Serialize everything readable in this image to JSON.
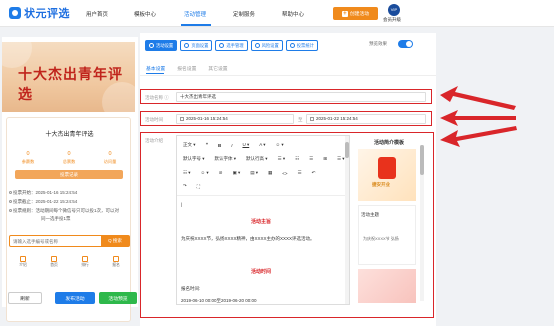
{
  "app": {
    "logo_text": "状元评选"
  },
  "topnav": {
    "items": [
      "用户首页",
      "模板中心",
      "活动管理",
      "定制服务",
      "帮助中心"
    ],
    "create_label": "创建活动",
    "vip_badge": "VIP",
    "vip_label": "会员升级"
  },
  "preview": {
    "banner_title": "十大杰出青年评选",
    "card_title": "十大杰出青年评选",
    "stats": [
      {
        "num": "0",
        "label": "参赛数"
      },
      {
        "num": "0",
        "label": "总票数"
      },
      {
        "num": "0",
        "label": "访问量"
      }
    ],
    "vote_record_label": "投票记录",
    "info": [
      "投票开始：2025-01-16 15:24:54",
      "投票截止：2025-01-22 15:24:54",
      "投票规则：活动期间每个微信号只可以投1次，可以对",
      "同一选手投1票"
    ],
    "search_placeholder": "请输入选手编号或名称",
    "search_button": "Q 搜索",
    "bottom_nav": [
      "介绍",
      "首页",
      "排行",
      "报名"
    ],
    "buttons": {
      "refresh": "刷新",
      "publish": "发布活动",
      "preview": "活动预览"
    }
  },
  "editor_panel": {
    "tool_tabs": [
      "活动设置",
      "页面设置",
      "选手管理",
      "风险设置",
      "投票统计"
    ],
    "preview_toggle_label": "预览效果",
    "sub_tabs": [
      "基本设置",
      "报名设置",
      "其它设置"
    ],
    "fields": {
      "name_label": "活动名称 ⓘ",
      "name_value": "十大杰出青年评选",
      "time_label": "活动时间",
      "start_time": "2025-01-16 15:24:54",
      "time_sep": "至",
      "end_time": "2025-01-22 15:24:54",
      "intro_label": "活动介绍"
    },
    "toolbar": {
      "row1": [
        "正文 ▾",
        "❝",
        "B",
        "I",
        "U ▾",
        "A ▾",
        "☺ ▾"
      ],
      "row2": [
        "默认字号 ▾",
        "默认字体 ▾",
        "默认行高 ▾",
        "☰ ▾",
        "☷",
        "☰",
        "⊞",
        "☰ ▾"
      ],
      "row3": [
        "☷ ▾",
        "☺ ▾",
        "⊘",
        "▣ ▾",
        "▤ ▾",
        "▦",
        "<>",
        "☰",
        "↶"
      ],
      "row4": [
        "↷",
        "⛶"
      ]
    },
    "doc": {
      "cursor_line": "|",
      "heading1": "活动主旨",
      "body1": "为庆祝XXXX节，弘扬XXXX精神，由XXXX主办的XXXX评选活动。",
      "heading2": "活动时间",
      "body2": "报名时间:",
      "body3": "2019-06-10 00:00至2019-06-20 00:00"
    },
    "samples": {
      "title": "活动简介模板",
      "s1_text": "捷安开业",
      "s2_title": "活动主题",
      "s2_text": "为庆祝XXXX节  弘扬"
    }
  },
  "colors": {
    "accent": "#1e7ce8",
    "orange": "#f08a1c",
    "green": "#2eb84b",
    "highlight": "#d9262a"
  }
}
